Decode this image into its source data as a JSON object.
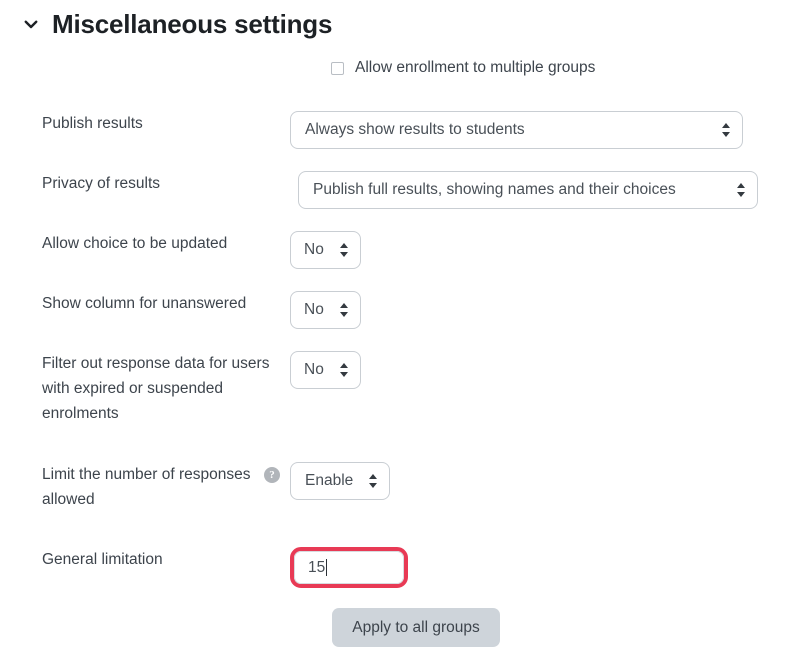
{
  "section": {
    "title": "Miscellaneous settings",
    "collapse_icon": "chevron-down-icon",
    "expanded": true
  },
  "colors": {
    "highlight": "#e83a55",
    "button_bg": "#ced4da",
    "label_text": "#3d444c",
    "border": "#c9ced3",
    "help_icon_bg": "#b1b5ba"
  },
  "checkbox_row": {
    "label": "Allow enrollment to multiple groups",
    "checked": false
  },
  "fields": [
    {
      "key": "publish_results",
      "label": "Publish results",
      "control": "select",
      "value": "Always show results to students"
    },
    {
      "key": "privacy_of_results",
      "label": "Privacy of results",
      "control": "select",
      "value": "Publish full results, showing names and their choices"
    },
    {
      "key": "allow_choice_updated",
      "label": "Allow choice to be updated",
      "control": "select",
      "value": "No"
    },
    {
      "key": "show_column_unanswered",
      "label": "Show column for unanswered",
      "control": "select",
      "value": "No"
    },
    {
      "key": "filter_expired",
      "label": "Filter out response data for users with expired or suspended enrolments",
      "control": "select",
      "value": "No"
    },
    {
      "key": "limit_responses",
      "label": "Limit the number of responses allowed",
      "control": "select",
      "value": "Enable",
      "help_icon": "help-circle-icon"
    },
    {
      "key": "general_limitation",
      "label": "General limitation",
      "control": "text",
      "value": "15",
      "highlighted": true,
      "focused": true
    }
  ],
  "button": {
    "label": "Apply to all groups"
  }
}
